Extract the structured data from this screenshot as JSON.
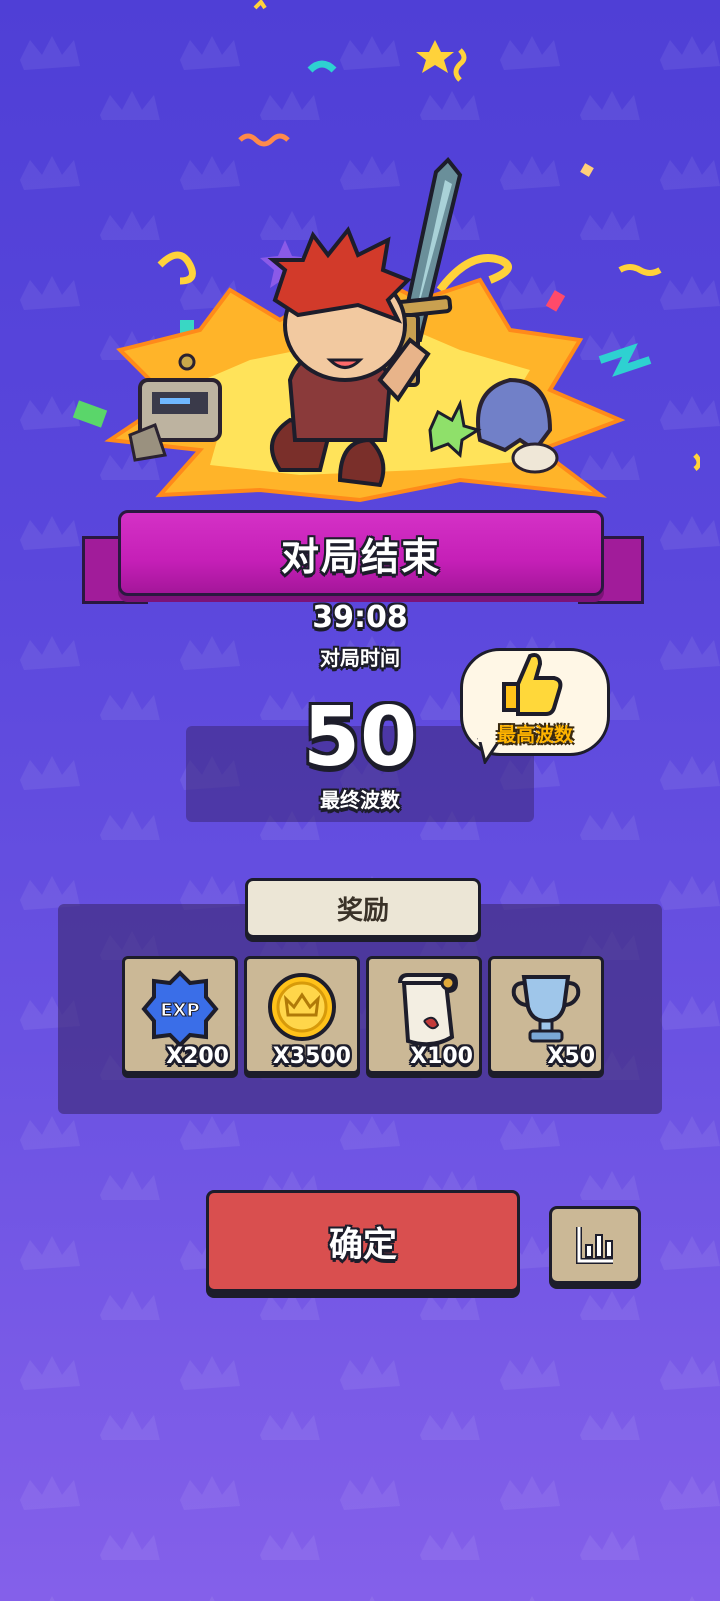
{
  "banner": {
    "title": "对局结束"
  },
  "match_time": {
    "value": "39:08",
    "label": "对局时间"
  },
  "final_wave": {
    "value": "50",
    "label": "最终波数"
  },
  "best_badge": {
    "label": "最高波数",
    "icon": "thumbs-up-icon"
  },
  "rewards": {
    "header": "奖励",
    "items": [
      {
        "icon": "exp-badge-icon",
        "badge_text": "EXP",
        "qty": "X200"
      },
      {
        "icon": "gold-coin-icon",
        "qty": "X3500"
      },
      {
        "icon": "scroll-icon",
        "qty": "X100"
      },
      {
        "icon": "trophy-icon",
        "qty": "X50"
      }
    ]
  },
  "buttons": {
    "confirm": "确定",
    "stats_icon": "bar-chart-icon"
  },
  "colors": {
    "background": "#5a47dc",
    "banner": "#c51fb7",
    "confirm": "#d94f4f",
    "reward_card": "#cbb896"
  }
}
